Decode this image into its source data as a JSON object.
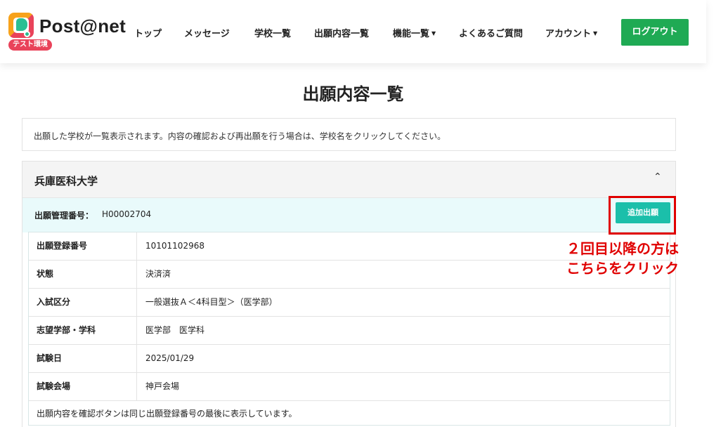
{
  "header": {
    "brand": "Post@net",
    "env_badge": "テスト環境",
    "nav": [
      {
        "label": "トップ",
        "dropdown": false
      },
      {
        "label": "メッセージ",
        "dropdown": false
      },
      {
        "label": "学校一覧",
        "dropdown": false
      },
      {
        "label": "出願内容一覧",
        "dropdown": false
      },
      {
        "label": "機能一覧",
        "dropdown": true
      },
      {
        "label": "よくあるご質問",
        "dropdown": false
      },
      {
        "label": "アカウント",
        "dropdown": true
      }
    ],
    "logout_label": "ログアウト",
    "caret": "▼"
  },
  "page": {
    "title": "出願内容一覧",
    "info_text": "出願した学校が一覧表示されます。内容の確認および再出願を行う場合は、学校名をクリックしてください。"
  },
  "card": {
    "school_name": "兵庫医科大学",
    "collapse_icon": "⌃",
    "management_label": "出願管理番号：",
    "management_value": "H00002704",
    "add_button_label": "追加出願",
    "rows": [
      {
        "label": "出願登録番号",
        "value": "10101102968"
      },
      {
        "label": "状態",
        "value": "決済済"
      },
      {
        "label": "入試区分",
        "value": "一般選抜Ａ＜4科目型＞（医学部）"
      },
      {
        "label": "志望学部・学科",
        "value": "医学部　医学科"
      },
      {
        "label": "試験日",
        "value": "2025/01/29"
      },
      {
        "label": "試験会場",
        "value": "神戸会場"
      }
    ],
    "note": "出願内容を確認ボタンは同じ出願登録番号の最後に表示しています。"
  },
  "annotation": {
    "line1": "２回目以降の方は",
    "line2": "こちらをクリック",
    "color": "#e00000"
  },
  "colors": {
    "logout_bg": "#1faa54",
    "add_button_bg": "#1bbfaa",
    "management_row_bg": "#e9fafb"
  }
}
